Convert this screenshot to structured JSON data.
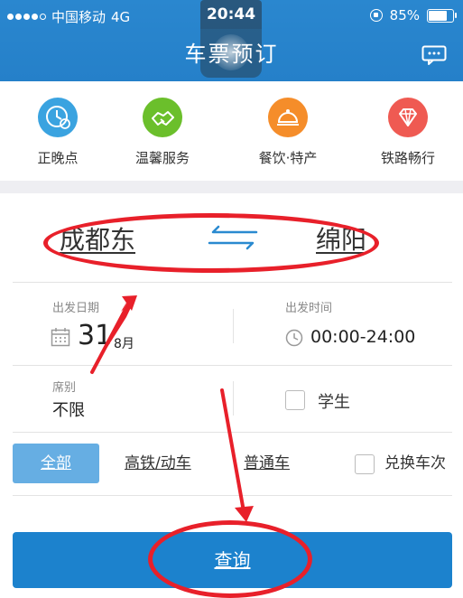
{
  "status_bar": {
    "carrier": "中国移动",
    "network": "4G",
    "time": "20:44",
    "battery": "85%",
    "battery_level": 0.85
  },
  "header": {
    "title": "车票预订",
    "message_icon": "message-icon"
  },
  "quick_actions": [
    {
      "label": "正晚点",
      "icon": "clock-icon",
      "color": "#3aa3e0"
    },
    {
      "label": "温馨服务",
      "icon": "handshake-icon",
      "color": "#6bbf2b"
    },
    {
      "label": "餐饮·特产",
      "icon": "food-cover-icon",
      "color": "#f58d2a"
    },
    {
      "label": "铁路畅行",
      "icon": "diamond-icon",
      "color": "#ef5a52"
    }
  ],
  "route": {
    "from": "成都东",
    "to": "绵阳",
    "swap_icon": "swap-arrows-icon"
  },
  "departure": {
    "date_label": "出发日期",
    "date_day": "31",
    "date_month": "8月",
    "time_label": "出发时间",
    "time_range": "00:00-24:00"
  },
  "seat": {
    "label": "席别",
    "value": "不限"
  },
  "student": {
    "label": "学生",
    "checked": false
  },
  "train_filters": {
    "all": "全部",
    "high_speed": "高铁/动车",
    "normal": "普通车",
    "transfer_label": "兑换车次"
  },
  "search_button": {
    "label": "查询"
  },
  "colors": {
    "header_blue": "#2580c9",
    "button_blue": "#1c82cd",
    "active_filter": "#66aee3",
    "annotation_red": "#e8202a"
  }
}
